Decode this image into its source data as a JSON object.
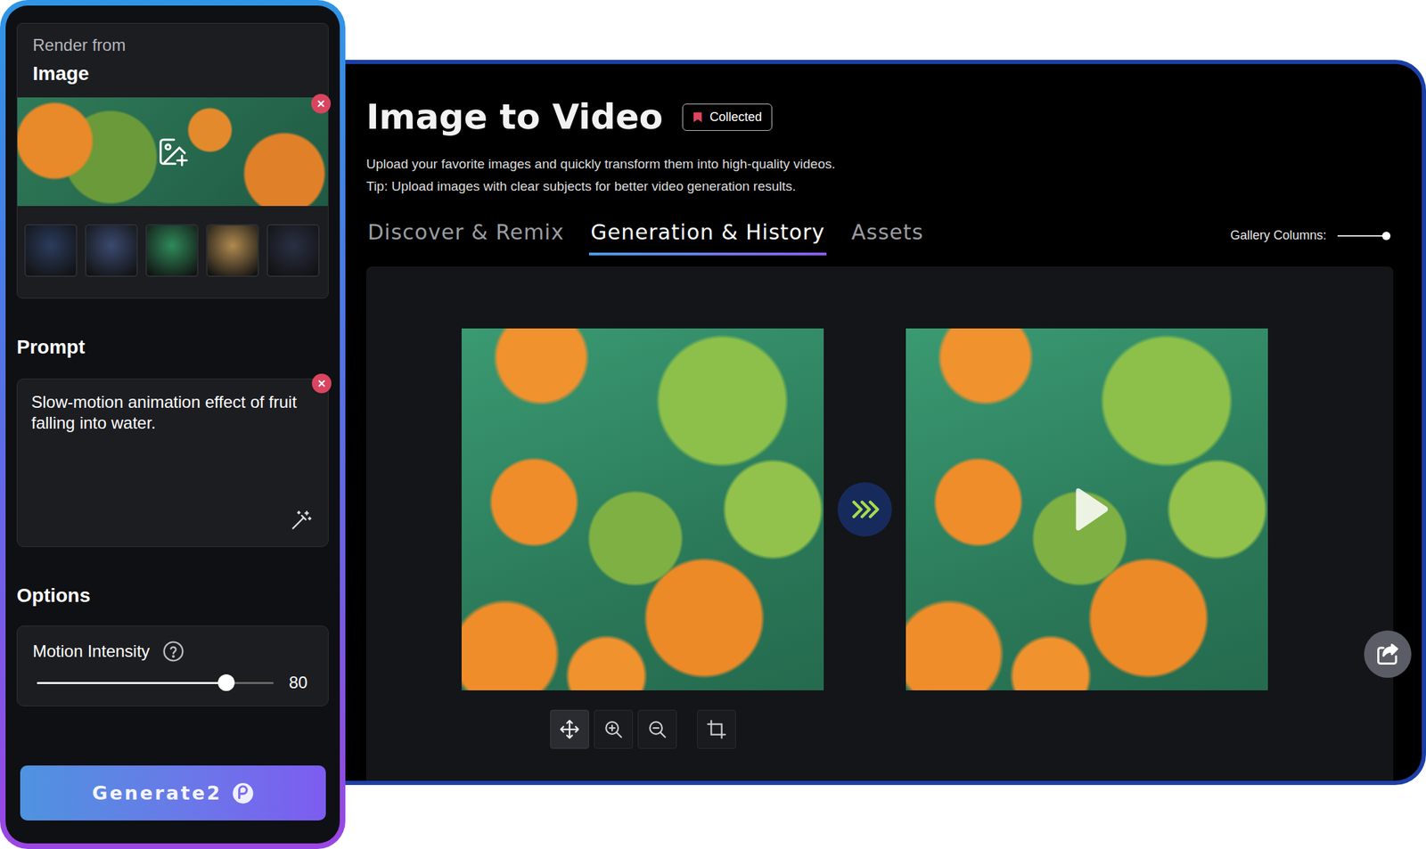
{
  "source_panel": {
    "label": "Render from",
    "source": "Image",
    "thumbnails": [
      {
        "color": "#2b3c5e"
      },
      {
        "color": "#3b4a70"
      },
      {
        "color": "#2f8a5a"
      },
      {
        "color": "#b08a50"
      },
      {
        "color": "#2a3044"
      }
    ]
  },
  "prompt": {
    "heading": "Prompt",
    "text": "Slow-motion animation effect of fruit falling into water."
  },
  "options": {
    "heading": "Options",
    "motion_intensity": {
      "label": "Motion Intensity",
      "level": 0.8,
      "reading": "80"
    }
  },
  "generate_button": {
    "label": "Generate2"
  },
  "header": {
    "title": "Image to Video",
    "badge": "Collected",
    "description": [
      "Upload your favorite images and quickly transform them into high-quality videos.",
      "Tip: Upload images with clear subjects for better video generation results."
    ]
  },
  "tabs": [
    {
      "label": "Discover & Remix",
      "selected": false
    },
    {
      "label": "Generation & History",
      "selected": true
    },
    {
      "label": "Assets",
      "selected": false
    }
  ],
  "gallery_columns": {
    "label": "Gallery Columns:",
    "level": 1
  },
  "toolbar": [
    {
      "kind": "move",
      "selected": true
    },
    {
      "kind": "zoom-in",
      "selected": false
    },
    {
      "kind": "zoom-out",
      "selected": false
    },
    {
      "kind": "crop",
      "selected": false
    }
  ]
}
